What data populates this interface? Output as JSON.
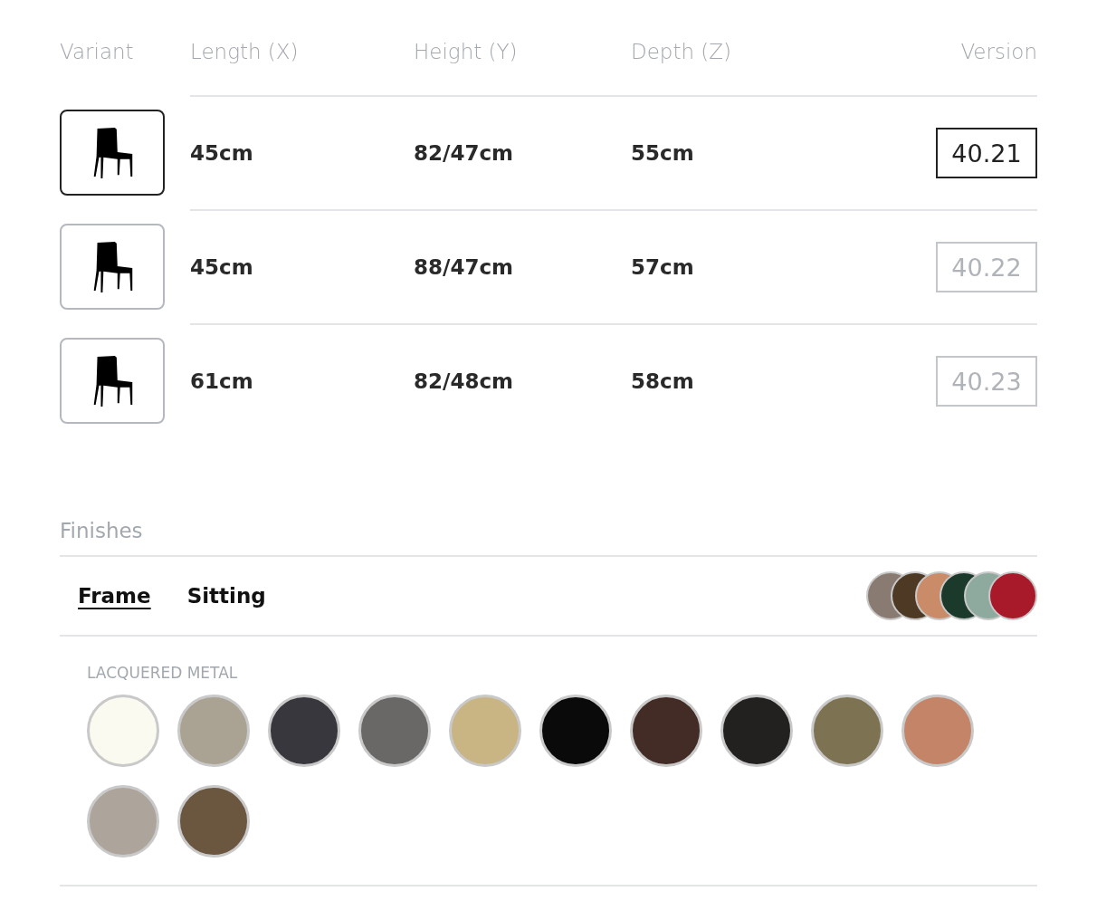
{
  "table": {
    "columns": [
      "Variant",
      "Length (X)",
      "Height (Y)",
      "Depth (Z)",
      "Version"
    ],
    "rows": [
      {
        "selected": true,
        "length": "45cm",
        "height": "82/47cm",
        "depth": "55cm",
        "version": "40.21"
      },
      {
        "selected": false,
        "length": "45cm",
        "height": "88/47cm",
        "depth": "57cm",
        "version": "40.22"
      },
      {
        "selected": false,
        "length": "61cm",
        "height": "82/48cm",
        "depth": "58cm",
        "version": "40.23"
      }
    ]
  },
  "finishes": {
    "title": "Finishes",
    "tabs": [
      {
        "label": "Frame",
        "selected": true
      },
      {
        "label": "Sitting",
        "selected": false
      }
    ],
    "preview": [
      {
        "color": "#8a7b72"
      },
      {
        "color": "#4e3a24"
      },
      {
        "color": "#c98b68"
      },
      {
        "color": "#1c3a2c"
      },
      {
        "color": "#8eaa9e"
      },
      {
        "color": "#a8192a"
      }
    ],
    "group": {
      "title": "LACQUERED METAL",
      "swatches": [
        {
          "color": "#fafaf0"
        },
        {
          "color": "#aaa293"
        },
        {
          "color": "#38373d"
        },
        {
          "color": "#6a6866"
        },
        {
          "color": "#c9b584"
        },
        {
          "color": "#0a0a0a"
        },
        {
          "color": "#432c25"
        },
        {
          "color": "#222120"
        },
        {
          "color": "#7d7252"
        },
        {
          "color": "#c48467"
        },
        {
          "color": "#ada59b"
        },
        {
          "color": "#6b5640"
        }
      ]
    }
  }
}
